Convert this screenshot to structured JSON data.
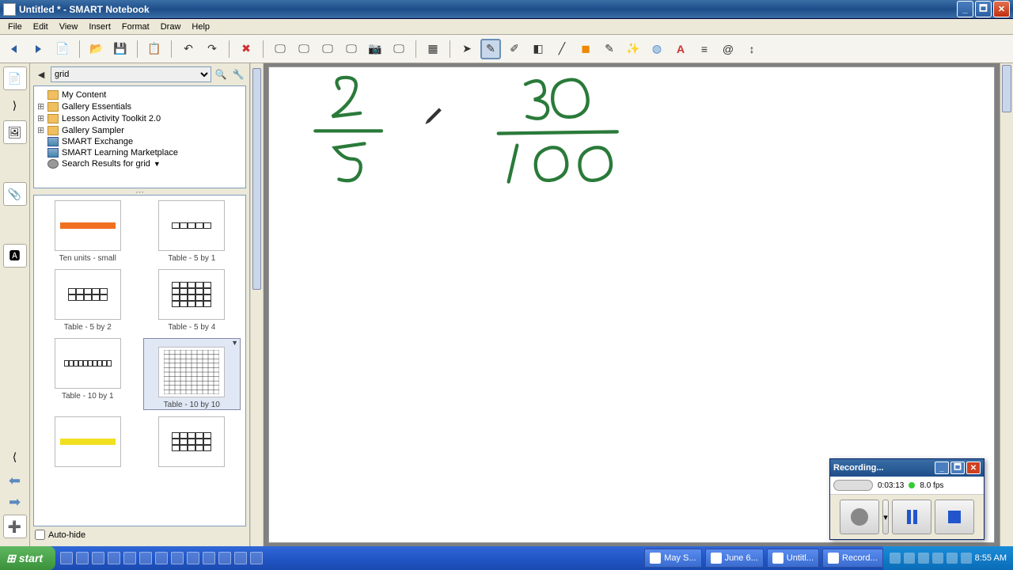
{
  "titlebar": {
    "title": "Untitled * - SMART Notebook"
  },
  "menu": {
    "file": "File",
    "edit": "Edit",
    "view": "View",
    "insert": "Insert",
    "format": "Format",
    "draw": "Draw",
    "help": "Help"
  },
  "search": {
    "value": "grid"
  },
  "tree": {
    "items": [
      {
        "label": "My Content",
        "expander": "",
        "iconClass": "ticon"
      },
      {
        "label": "Gallery Essentials",
        "expander": "⊞",
        "iconClass": "ticon"
      },
      {
        "label": "Lesson Activity Toolkit 2.0",
        "expander": "⊞",
        "iconClass": "ticon"
      },
      {
        "label": "Gallery Sampler",
        "expander": "⊞",
        "iconClass": "ticon"
      },
      {
        "label": "SMART Exchange",
        "expander": "",
        "iconClass": "ticon g"
      },
      {
        "label": "SMART Learning Marketplace",
        "expander": "",
        "iconClass": "ticon g"
      },
      {
        "label": "Search Results for grid",
        "expander": "",
        "iconClass": "ticon s"
      }
    ]
  },
  "gallery": {
    "items": [
      {
        "label": "Ten units - small"
      },
      {
        "label": "Table - 5 by 1"
      },
      {
        "label": "Table - 5 by 2"
      },
      {
        "label": "Table - 5 by 4"
      },
      {
        "label": "Table - 10 by 1"
      },
      {
        "label": "Table - 10 by 10"
      }
    ],
    "autohide": "Auto-hide"
  },
  "canvas": {
    "frac1_num": "2",
    "frac1_den": "5",
    "frac2_num": "30",
    "frac2_den": "100"
  },
  "recording": {
    "title": "Recording...",
    "time": "0:03:13",
    "fps": "8.0 fps"
  },
  "taskbar": {
    "start": "start",
    "tasks": [
      "May S...",
      "June 6...",
      "Untitl...",
      "Record..."
    ],
    "clock": "8:55 AM"
  }
}
